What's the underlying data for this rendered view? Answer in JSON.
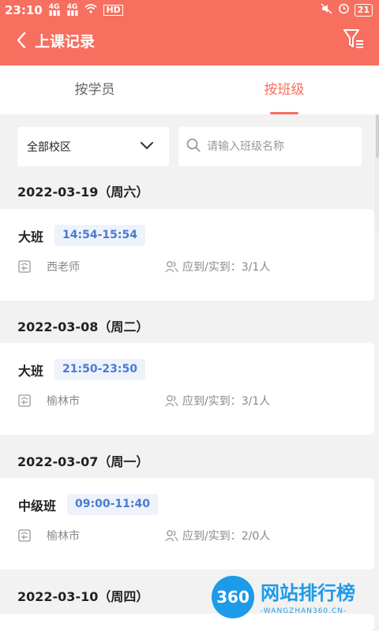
{
  "status_bar": {
    "time": "23:10",
    "sig1": "4G",
    "sig2": "4G",
    "hd": "HD",
    "battery": "21"
  },
  "nav": {
    "title": "上课记录"
  },
  "tabs": [
    {
      "label": "按学员",
      "active": false
    },
    {
      "label": "按班级",
      "active": true
    }
  ],
  "filters": {
    "campus": "全部校区",
    "search_placeholder": "请输入班级名称"
  },
  "attendance_label": "应到/实到：",
  "records": [
    {
      "date": "2022-03-19（周六）",
      "class_name": "大班",
      "time": "14:54-15:54",
      "teacher": "西老师",
      "attendance": "3/1人"
    },
    {
      "date": "2022-03-08（周二）",
      "class_name": "大班",
      "time": "21:50-23:50",
      "teacher": "榆林市",
      "attendance": "3/1人"
    },
    {
      "date": "2022-03-07（周一）",
      "class_name": "中级班",
      "time": "09:00-11:40",
      "teacher": "榆林市",
      "attendance": "2/0人"
    },
    {
      "date": "2022-03-10（周四）"
    }
  ],
  "watermark": {
    "logo_text": "360",
    "title": "网站排行榜",
    "subtitle": "-WANGZHAN360.CN-"
  },
  "colors": {
    "accent": "#f76f5f",
    "badge_text": "#4a7bd0",
    "badge_bg": "#eef2fb",
    "watermark": "#1d9be8"
  },
  "icons": [
    "back-icon",
    "filter-icon",
    "chevron-down-icon",
    "search-icon",
    "teacher-icon",
    "people-icon",
    "wifi-icon",
    "mute-icon",
    "alarm-icon"
  ]
}
